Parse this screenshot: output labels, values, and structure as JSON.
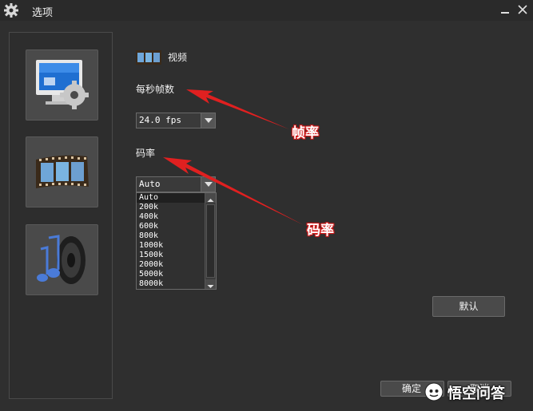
{
  "window": {
    "title": "选项"
  },
  "sidebar": {
    "items": [
      {
        "name": "general-settings",
        "icon": "monitor-gear-icon"
      },
      {
        "name": "video-settings",
        "icon": "film-strip-icon"
      },
      {
        "name": "audio-settings",
        "icon": "speaker-icon"
      }
    ]
  },
  "video": {
    "section_label": "视频",
    "fps_label": "每秒帧数",
    "fps_value": "24.0 fps",
    "bitrate_label": "码率",
    "bitrate_value": "Auto",
    "bitrate_options": [
      "Auto",
      "200k",
      "400k",
      "600k",
      "800k",
      "1000k",
      "1500k",
      "2000k",
      "5000k",
      "8000k"
    ],
    "selected_bitrate_index": 0
  },
  "annotations": {
    "fps": "帧率",
    "bitrate": "码率",
    "color": "#e02020"
  },
  "buttons": {
    "default_label": "默认",
    "ok_label": "确定",
    "cancel_label": "取消"
  },
  "watermark": {
    "text": "悟空问答"
  },
  "colors": {
    "background": "#2f2f2f",
    "panel": "#4a4a4a",
    "accent_red": "#e02020"
  }
}
